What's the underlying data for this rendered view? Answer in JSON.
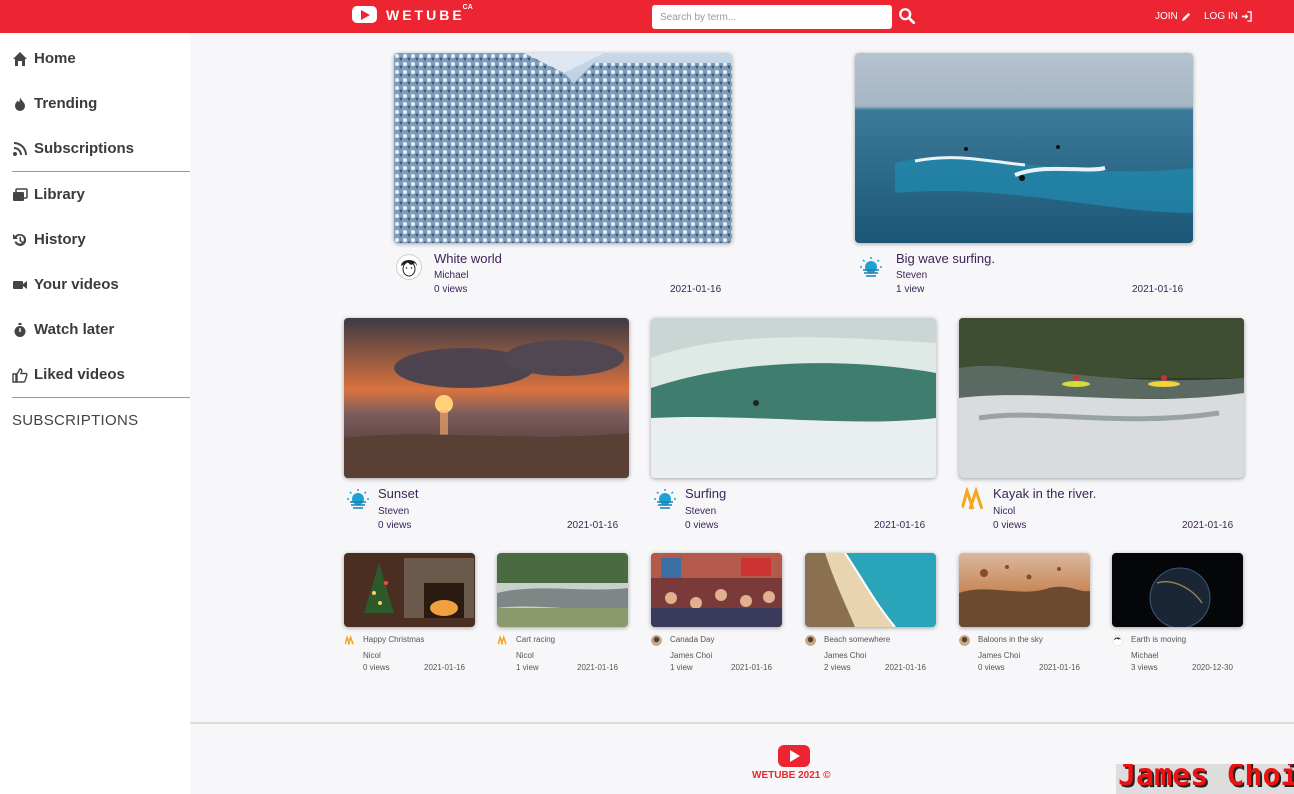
{
  "header": {
    "logo_text": "WETUBE",
    "logo_sup": "CA",
    "search_placeholder": "Search by term...",
    "join_label": "JOIN",
    "login_label": "LOG IN"
  },
  "sidebar": {
    "items": [
      {
        "label": "Home",
        "icon": "home-icon"
      },
      {
        "label": "Trending",
        "icon": "fire-icon"
      },
      {
        "label": "Subscriptions",
        "icon": "satellite-icon"
      },
      {
        "label": "Library",
        "icon": "library-icon"
      },
      {
        "label": "History",
        "icon": "history-icon"
      },
      {
        "label": "Your videos",
        "icon": "video-camera-icon"
      },
      {
        "label": "Watch later",
        "icon": "stopwatch-icon"
      },
      {
        "label": "Liked videos",
        "icon": "thumbs-up-icon"
      }
    ],
    "subscriptions_heading": "SUBSCRIPTIONS"
  },
  "videos": [
    {
      "title": "White world",
      "author": "Michael",
      "views": "0 views",
      "date": "2021-01-16"
    },
    {
      "title": "Big wave surfing.",
      "author": "Steven",
      "views": "1 view",
      "date": "2021-01-16"
    },
    {
      "title": "Sunset",
      "author": "Steven",
      "views": "0 views",
      "date": "2021-01-16"
    },
    {
      "title": "Surfing",
      "author": "Steven",
      "views": "0 views",
      "date": "2021-01-16"
    },
    {
      "title": "Kayak in the river.",
      "author": "Nicol",
      "views": "0 views",
      "date": "2021-01-16"
    },
    {
      "title": "Happy Christmas",
      "author": "Nicol",
      "views": "0 views",
      "date": "2021-01-16"
    },
    {
      "title": "Cart racing",
      "author": "Nicol",
      "views": "1 view",
      "date": "2021-01-16"
    },
    {
      "title": "Canada Day",
      "author": "James Choi",
      "views": "1 view",
      "date": "2021-01-16"
    },
    {
      "title": "Beach somewhere",
      "author": "James Choi",
      "views": "2 views",
      "date": "2021-01-16"
    },
    {
      "title": "Baloons in the sky",
      "author": "James Choi",
      "views": "0 views",
      "date": "2021-01-16"
    },
    {
      "title": "Earth is moving",
      "author": "Michael",
      "views": "3 views",
      "date": "2020-12-30"
    }
  ],
  "footer": {
    "text": "WETUBE 2021 ©",
    "signature": "James Choi"
  },
  "colors": {
    "brand": "#ed2431",
    "title_text": "#3c2457"
  }
}
